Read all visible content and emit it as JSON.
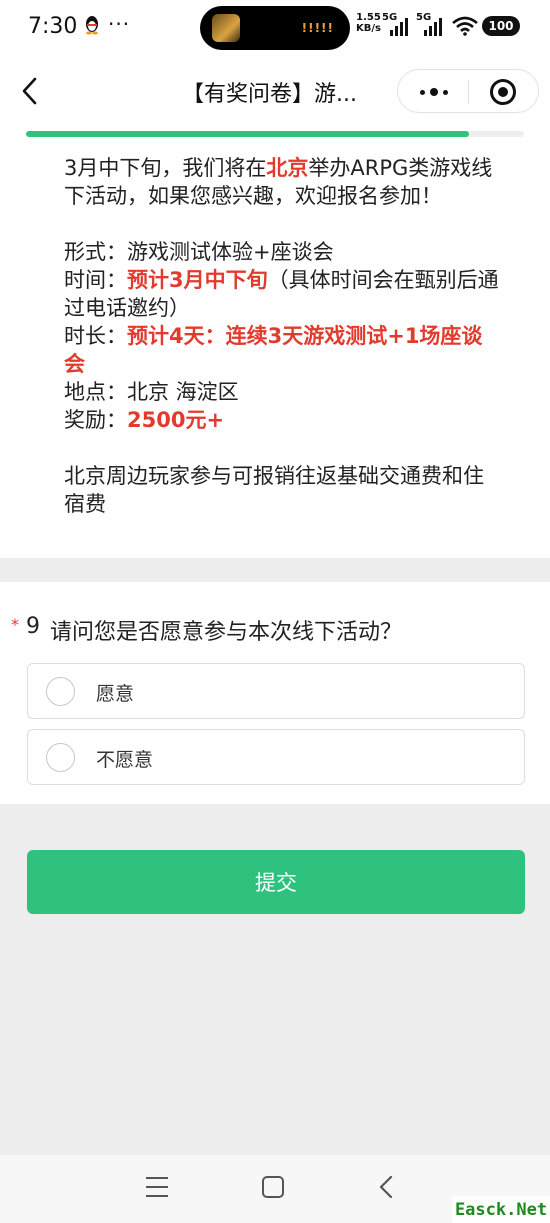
{
  "status_bar": {
    "time": "7:30",
    "dots": "···",
    "net_speed_value": "1.55",
    "net_speed_unit": "KB/s",
    "signal1_label": "5G",
    "signal2_label": "5G",
    "battery": "100",
    "island_bars": "!!!!!"
  },
  "nav": {
    "title": "【有奖问卷】游..."
  },
  "progress": {
    "fraction": 0.89
  },
  "intro": {
    "p1_a": "3月中下旬，我们将在",
    "p1_city": "北京",
    "p1_b": "举办ARPG类游戏线下活动，如果您感兴趣，欢迎报名参加！",
    "format_label": "形式：",
    "format_value": "游戏测试体验+座谈会",
    "time_label": "时间：",
    "time_value": "预计3月中下旬",
    "time_note": "（具体时间会在甄别后通过电话邀约）",
    "duration_label": "时长：",
    "duration_value": "预计4天：连续3天游戏测试+1场座谈会",
    "location_label": "地点：",
    "location_value": "北京 海淀区",
    "reward_label": "奖励：",
    "reward_value": "2500元+",
    "p3": "北京周边玩家参与可报销往返基础交通费和住宿费"
  },
  "question": {
    "required_mark": "*",
    "number": "9",
    "text": "请问您是否愿意参与本次线下活动？",
    "options": [
      "愿意",
      "不愿意"
    ]
  },
  "submit_label": "提交",
  "watermark": "Easck.Net",
  "colors": {
    "accent": "#2ec27e",
    "highlight_red": "#e23b2e"
  }
}
